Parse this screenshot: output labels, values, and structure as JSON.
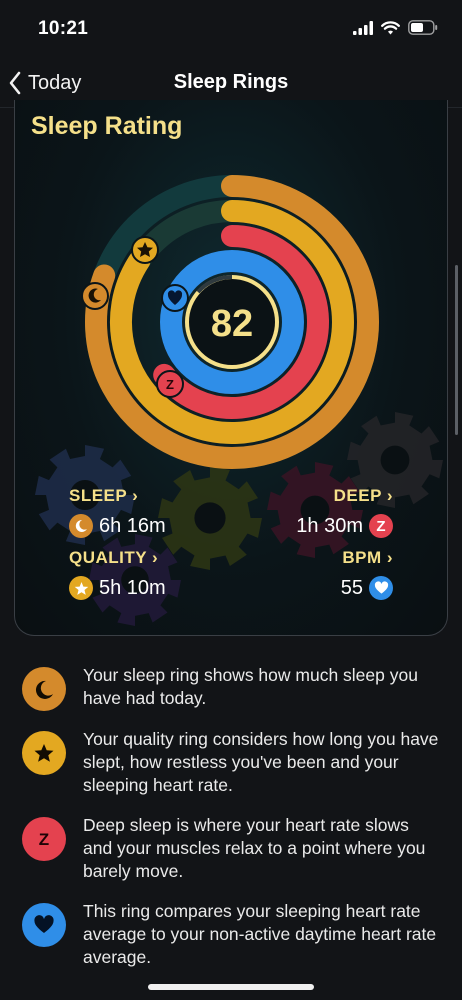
{
  "status": {
    "time": "10:21"
  },
  "nav": {
    "back_label": "Today",
    "title": "Sleep Rings"
  },
  "card": {
    "title": "Sleep Rating",
    "score": "82",
    "rings": [
      {
        "name": "sleep",
        "color": "#d48a2c"
      },
      {
        "name": "quality",
        "color": "#e3a821"
      },
      {
        "name": "deep",
        "color": "#e4424f"
      },
      {
        "name": "bpm",
        "color": "#2f8ee8"
      }
    ],
    "stats": {
      "sleep": {
        "label": "SLEEP ›",
        "value": "6h 16m",
        "icon": "moon-icon",
        "color": "#d48a2c"
      },
      "deep": {
        "label": "DEEP ›",
        "value": "1h 30m",
        "icon": "z-icon",
        "color": "#e4424f"
      },
      "quality": {
        "label": "QUALITY ›",
        "value": "5h 10m",
        "icon": "star-icon",
        "color": "#e3a821"
      },
      "bpm": {
        "label": "BPM ›",
        "value": "55",
        "icon": "heart-icon",
        "color": "#2f8ee8"
      }
    }
  },
  "legend": [
    {
      "icon": "moon-icon",
      "color": "#d48a2c",
      "text": "Your sleep ring shows how much sleep you have had today."
    },
    {
      "icon": "star-icon",
      "color": "#e3a821",
      "text": "Your quality ring considers how long you have slept, how restless you've been and your sleeping heart rate."
    },
    {
      "icon": "z-icon",
      "color": "#e4424f",
      "text": "Deep sleep is where your heart rate slows and your muscles relax to a point where you barely move."
    },
    {
      "icon": "heart-icon",
      "color": "#2f8ee8",
      "text": "This ring compares your sleeping heart rate average to your non-active daytime heart rate average."
    }
  ]
}
